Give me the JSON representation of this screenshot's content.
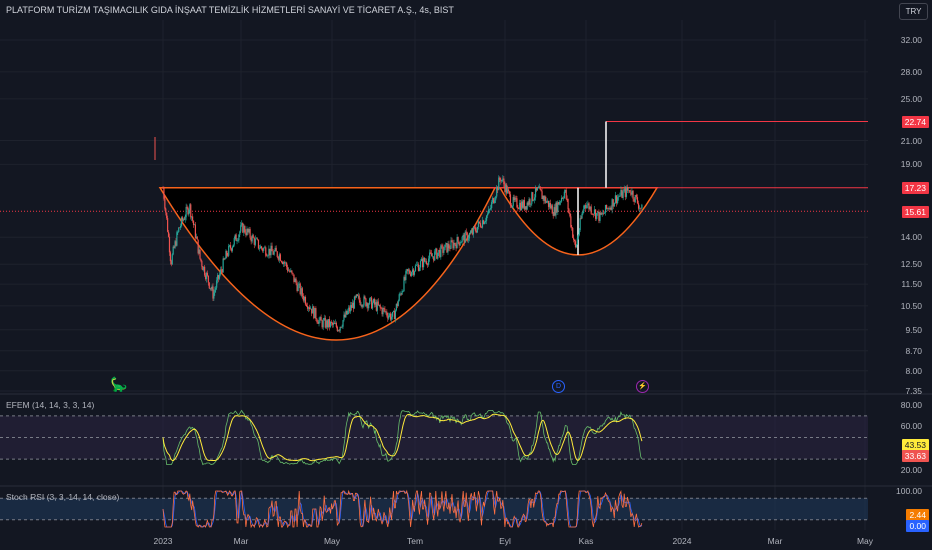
{
  "header": {
    "title": "PLATFORM TURİZM TAŞIMACILIK GIDA İNŞAAT TEMİZLİK HİZMETLERİ SANAYİ VE TİCARET A.Ş., 4s, BIST",
    "currency": "TRY"
  },
  "price_axis": {
    "ticks": [
      "32.00",
      "28.00",
      "25.00",
      "21.00",
      "19.00",
      "14.00",
      "12.50",
      "11.50",
      "10.50",
      "9.50",
      "8.70",
      "8.00",
      "7.35"
    ]
  },
  "price_tags": {
    "target": "22.74",
    "resistance": "17.23",
    "last": "15.61"
  },
  "time_axis": [
    "2023",
    "Mar",
    "May",
    "Tem",
    "Eyl",
    "Kas",
    "2024",
    "Mar",
    "May"
  ],
  "events": {
    "dividend": "D",
    "split": "⚡"
  },
  "efem": {
    "label": "EFEM (14, 14, 3, 3, 14)",
    "ticks": [
      "80.00",
      "60.00",
      "20.00"
    ],
    "value_k": "43.53",
    "value_d": "33.63"
  },
  "stoch_rsi": {
    "label": "Stoch RSI (3, 3, 14, 14, close)",
    "ticks": [
      "100.00"
    ],
    "value_k": "2.44",
    "value_d": "0.00"
  },
  "colors": {
    "up": "#26a69a",
    "down": "#ef5350",
    "cup": "#f7631b",
    "line": "#f23645",
    "bg": "#131722"
  },
  "chart_data": {
    "type": "line",
    "title": "PLATFORM TURİZM ... 4s, BIST",
    "scale": "log",
    "ylim": [
      7.35,
      34
    ],
    "series": [
      {
        "name": "close",
        "points": [
          [
            0,
            17.2
          ],
          [
            6,
            12.6
          ],
          [
            12,
            14.5
          ],
          [
            20,
            16.0
          ],
          [
            28,
            12.8
          ],
          [
            38,
            11.0
          ],
          [
            48,
            13.0
          ],
          [
            60,
            14.6
          ],
          [
            72,
            13.4
          ],
          [
            85,
            13.0
          ],
          [
            100,
            11.0
          ],
          [
            112,
            9.8
          ],
          [
            125,
            9.6
          ],
          [
            138,
            10.8
          ],
          [
            150,
            10.6
          ],
          [
            165,
            10.0
          ],
          [
            175,
            12.0
          ],
          [
            190,
            12.8
          ],
          [
            205,
            13.5
          ],
          [
            220,
            14.2
          ],
          [
            232,
            15.5
          ],
          [
            240,
            18.0
          ],
          [
            248,
            16.2
          ],
          [
            258,
            16.0
          ],
          [
            268,
            17.0
          ],
          [
            280,
            15.6
          ],
          [
            288,
            17.0
          ],
          [
            296,
            13.3
          ],
          [
            303,
            16.2
          ],
          [
            313,
            15.2
          ],
          [
            323,
            16.5
          ],
          [
            332,
            17.1
          ],
          [
            340,
            15.6
          ]
        ]
      }
    ],
    "patterns": [
      {
        "name": "cup-large",
        "rim": 17.23,
        "bottom": 9.1
      },
      {
        "name": "cup-small",
        "rim": 17.23,
        "bottom": 13.0
      }
    ],
    "levels": {
      "resistance": 17.23,
      "target": 22.74,
      "last": 15.61
    }
  }
}
